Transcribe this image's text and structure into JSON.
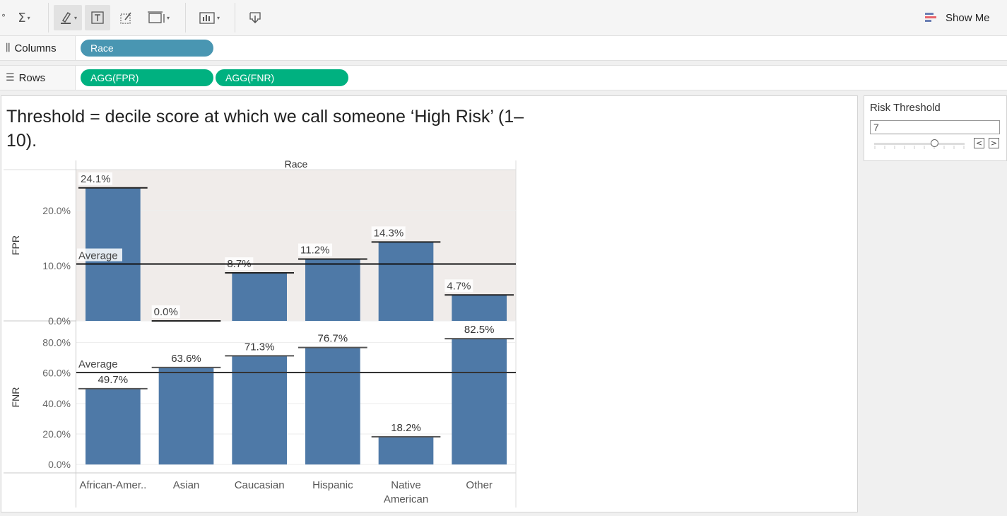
{
  "toolbar": {
    "show_me_label": "Show Me",
    "sigma_symbol": "Σ"
  },
  "shelves": {
    "columns": {
      "label": "Columns",
      "pills": [
        "Race"
      ]
    },
    "rows": {
      "label": "Rows",
      "pills": [
        "AGG(FPR)",
        "AGG(FNR)"
      ]
    }
  },
  "sheet": {
    "title": "Threshold = decile score at which we call someone ‘High Risk’ (1–10).",
    "header_label": "Race"
  },
  "parameter": {
    "title": "Risk Threshold",
    "value": "7",
    "min": 1,
    "max": 10
  },
  "colors": {
    "bar": "#4e79a7",
    "pill_blue": "#4996b2",
    "pill_green": "#00b180",
    "fpr_panel_bg": "#f0ecea"
  },
  "chart_data": [
    {
      "type": "bar",
      "ylabel": "FPR",
      "categories": [
        "African-Amer..",
        "Asian",
        "Caucasian",
        "Hispanic",
        "Native American",
        "Other"
      ],
      "values": [
        24.1,
        0.0,
        8.7,
        11.2,
        14.3,
        4.7
      ],
      "labels": [
        "24.1%",
        "0.0%",
        "8.7%",
        "11.2%",
        "14.3%",
        "4.7%"
      ],
      "yticks": [
        "0.0%",
        "10.0%",
        "20.0%"
      ],
      "ylim": [
        0,
        27.4
      ],
      "reference_line": {
        "label": "Average",
        "value": 10.3
      }
    },
    {
      "type": "bar",
      "ylabel": "FNR",
      "categories": [
        "African-Amer..",
        "Asian",
        "Caucasian",
        "Hispanic",
        "Native American",
        "Other"
      ],
      "values": [
        49.7,
        63.6,
        71.3,
        76.7,
        18.2,
        82.5
      ],
      "labels": [
        "49.7%",
        "63.6%",
        "71.3%",
        "76.7%",
        "18.2%",
        "82.5%"
      ],
      "yticks": [
        "0.0%",
        "20.0%",
        "40.0%",
        "60.0%",
        "80.0%"
      ],
      "ylim": [
        -5.5,
        93.7
      ],
      "reference_line": {
        "label": "Average",
        "value": 60.3
      }
    }
  ],
  "x_axis": {
    "label_lines": [
      [
        "African-Amer.."
      ],
      [
        "Asian"
      ],
      [
        "Caucasian"
      ],
      [
        "Hispanic"
      ],
      [
        "Native",
        "American"
      ],
      [
        "Other"
      ]
    ]
  }
}
